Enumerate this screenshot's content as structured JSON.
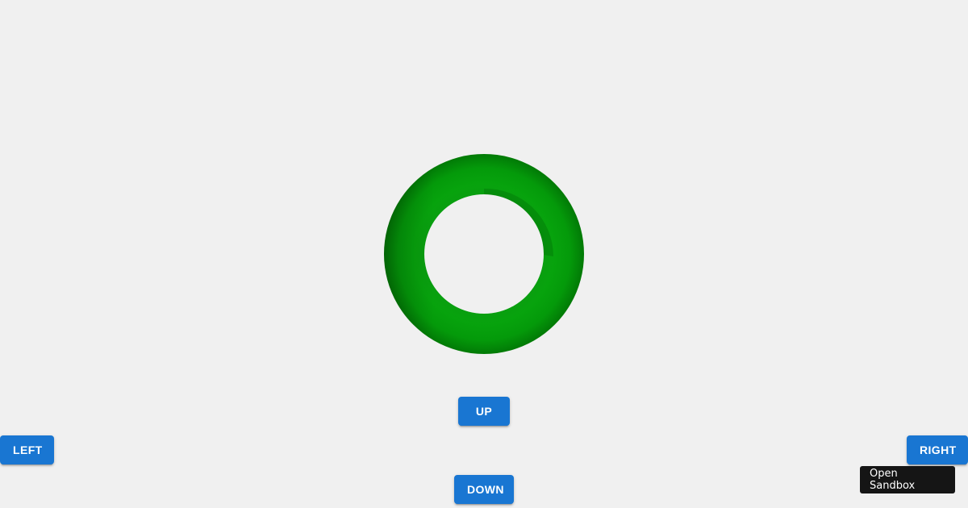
{
  "scene": {
    "object_name": "torus",
    "colors": {
      "background": "#f0f0f0",
      "torus_base": "#049a0c",
      "torus_shadow": "#026d06",
      "button_bg": "#1976d2",
      "button_text": "#ffffff",
      "sandbox_bg": "#151515"
    }
  },
  "controls": {
    "up_label": "UP",
    "down_label": "DOWN",
    "left_label": "LEFT",
    "right_label": "RIGHT"
  },
  "sandbox": {
    "label": "Open Sandbox"
  }
}
